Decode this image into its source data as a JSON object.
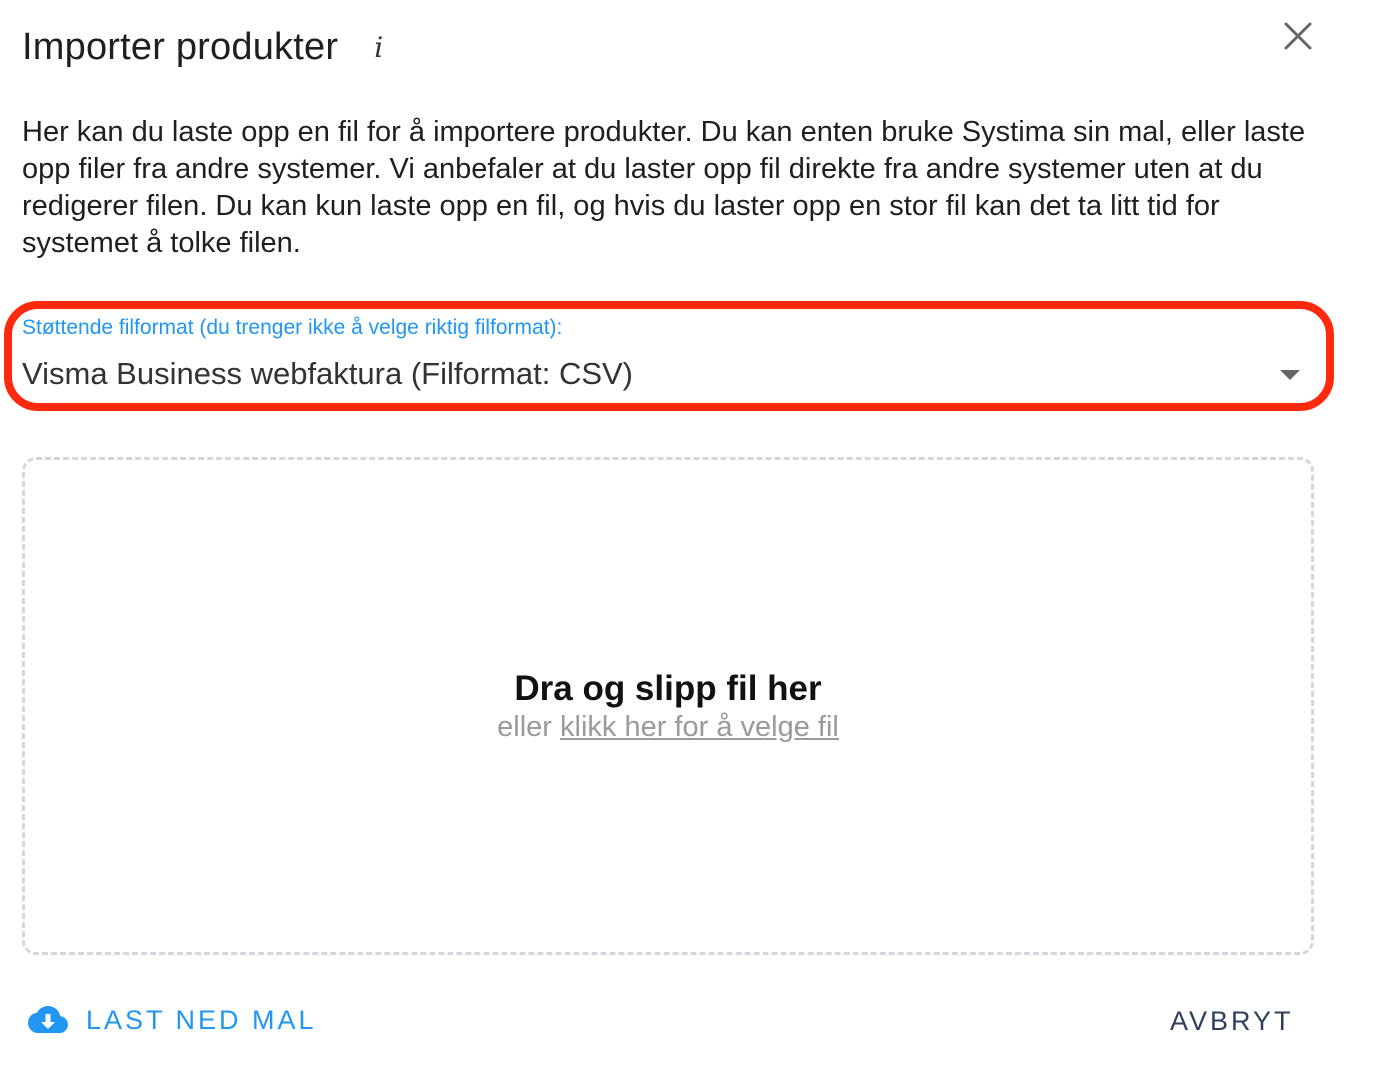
{
  "dialog": {
    "title": "Importer produkter",
    "info_icon": "i",
    "close_icon": "close-icon",
    "description": "Her kan du laste opp en fil for å importere produkter. Du kan enten bruke Systima sin mal, eller laste opp filer fra andre systemer. Vi anbefaler at du laster opp fil direkte fra andre systemer uten at du redigerer filen. Du kan kun laste opp en fil, og hvis du laster opp en stor fil kan det ta litt tid for systemet å tolke filen."
  },
  "format_select": {
    "label": "Støttende filformat (du trenger ikke å velge riktig filformat):",
    "selected_value": "Visma Business webfaktura (Filformat: CSV)",
    "highlight_color": "#ff2a0e"
  },
  "dropzone": {
    "title": "Dra og slipp fil her",
    "subtitle_prefix": "eller ",
    "link_text": "klikk her for å velge fil"
  },
  "footer": {
    "download_label": "LAST NED MAL",
    "download_icon": "cloud-download-icon",
    "cancel_label": "AVBRYT"
  },
  "colors": {
    "accent": "#2196f3",
    "cancel_text": "#2f3f5c",
    "dropzone_border": "#d3d6dc"
  }
}
